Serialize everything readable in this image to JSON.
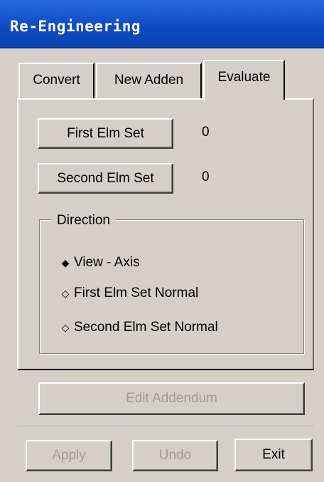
{
  "window": {
    "title": "Re-Engineering"
  },
  "tabs": [
    {
      "label": "Convert"
    },
    {
      "label": "New Adden"
    },
    {
      "label": "Evaluate",
      "active": true
    }
  ],
  "evaluate": {
    "first_elm_set": {
      "label": "First Elm Set",
      "value": "0"
    },
    "second_elm_set": {
      "label": "Second Elm Set",
      "value": "0"
    },
    "direction": {
      "title": "Direction",
      "options": [
        {
          "label": "View - Axis",
          "selected": true
        },
        {
          "label": "First Elm Set Normal",
          "selected": false
        },
        {
          "label": "Second Elm Set Normal",
          "selected": false
        }
      ]
    }
  },
  "edit_addendum_label": "Edit Addendum",
  "footer": {
    "apply_label": "Apply",
    "undo_label": "Undo",
    "exit_label": "Exit"
  },
  "icons": {
    "radio_selected": "◆",
    "radio_unselected": "◇"
  },
  "colors": {
    "titlebar": "#0d4bc2",
    "face": "#d4d0c8",
    "disabled_text": "#a09c95"
  }
}
